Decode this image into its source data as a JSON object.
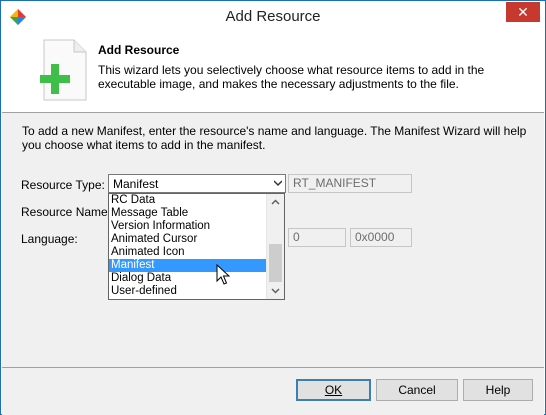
{
  "window": {
    "title": "Add Resource",
    "close_glyph": "✕"
  },
  "header": {
    "title": "Add Resource",
    "description": "This wizard lets you selectively choose what resource items to add in the executable image, and makes the necessary adjustments to the file."
  },
  "intro_text": "To add a new Manifest, enter the resource's name and language. The Manifest Wizard will help you choose what items to add in the manifest.",
  "form": {
    "resource_type_label": "Resource Type:",
    "resource_type_value": "Manifest",
    "resource_type_id": "RT_MANIFEST",
    "resource_name_label": "Resource Name:",
    "language_label": "Language:",
    "language_value": "0",
    "language_hex": "0x0000"
  },
  "dropdown": {
    "items": [
      "RC Data",
      "Message Table",
      "Version Information",
      "Animated Cursor",
      "Animated Icon",
      "Manifest",
      "Dialog Data",
      "User-defined"
    ],
    "selected": "Manifest"
  },
  "buttons": {
    "ok_label": "OK",
    "cancel_label": "Cancel",
    "help_label": "Help"
  },
  "icons": [
    "app-icon",
    "add-resource-icon",
    "chevron-down-icon",
    "scroll-up-icon",
    "scroll-down-icon",
    "mouse-cursor-icon"
  ],
  "colors": {
    "selection": "#3399ff",
    "close_button": "#c7382e",
    "plus": "#3fbf4a"
  }
}
